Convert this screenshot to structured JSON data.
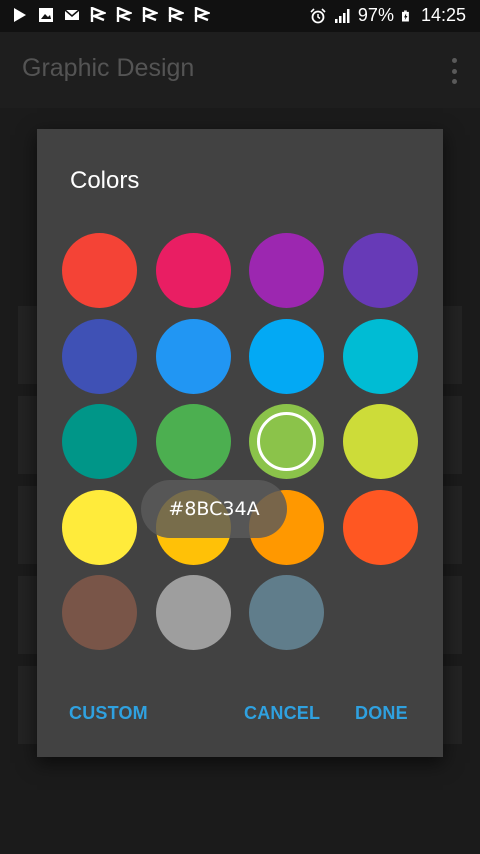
{
  "status_bar": {
    "battery": "97%",
    "time": "14:25",
    "icons": [
      "play-icon",
      "image-icon",
      "mail-icon",
      "flag-icon",
      "flag-icon",
      "flag-icon",
      "flag-icon",
      "flag-icon",
      "alarm-icon",
      "signal-icon",
      "battery-icon"
    ]
  },
  "app_bar": {
    "title": "Graphic Design",
    "menu_icon": "more-vert-icon"
  },
  "dialog": {
    "title": "Colors",
    "swatches": [
      {
        "color": "#F44336"
      },
      {
        "color": "#E91E63"
      },
      {
        "color": "#9C27B0"
      },
      {
        "color": "#673AB7"
      },
      {
        "color": "#3F51B5"
      },
      {
        "color": "#2196F3"
      },
      {
        "color": "#03A9F4"
      },
      {
        "color": "#00BCD4"
      },
      {
        "color": "#009688"
      },
      {
        "color": "#4CAF50"
      },
      {
        "color": "#8BC34A",
        "selected": true
      },
      {
        "color": "#CDDC39"
      },
      {
        "color": "#FFEB3B"
      },
      {
        "color": "#FFC107"
      },
      {
        "color": "#FF9800"
      },
      {
        "color": "#FF5722"
      },
      {
        "color": "#795548"
      },
      {
        "color": "#9E9E9E"
      },
      {
        "color": "#607D8B"
      }
    ],
    "tooltip": "#8BC34A",
    "buttons": {
      "custom": "CUSTOM",
      "cancel": "CANCEL",
      "done": "DONE"
    },
    "accent": "#2FA1E0"
  }
}
